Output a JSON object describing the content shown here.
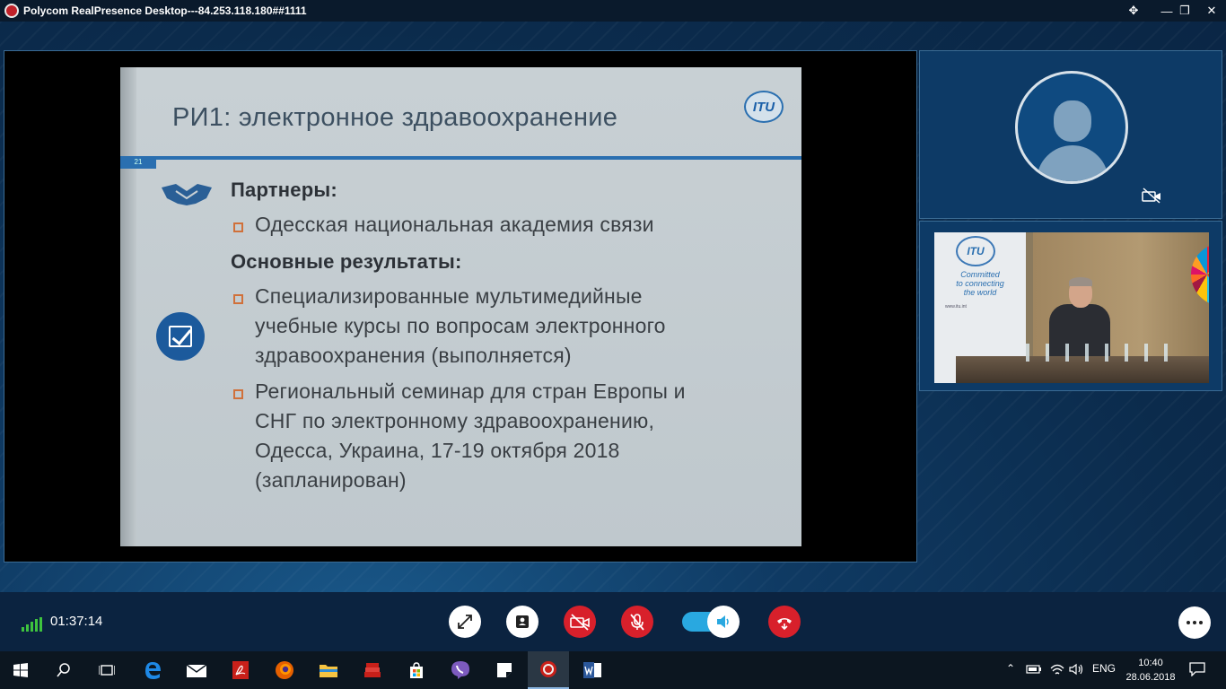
{
  "window": {
    "title": "Polycom RealPresence Desktop---84.253.118.180##1111",
    "pin": "✥",
    "minimize": "—",
    "maximize": "❐",
    "close": "✕"
  },
  "slide": {
    "title": "РИ1: электронное здравоохранение",
    "logo": "ITU",
    "page_number": "21",
    "partners_heading": "Партнеры:",
    "partners": [
      "Одесская национальная академия связи"
    ],
    "results_heading": "Основные результаты:",
    "result1": [
      "Специализированные мультимедийные",
      "учебные курсы по вопросам электронного",
      "здравоохранения (выполняется)"
    ],
    "result2": [
      "Региональный семинар для стран Европы и",
      "СНГ по электронному здравоохранению,",
      "Одесса, Украина, 17-19 октября 2018",
      "(запланирован)"
    ]
  },
  "room_video": {
    "logo": "ITU",
    "tagline": [
      "Committed",
      "to connecting",
      "the world"
    ],
    "url": "www.itu.int"
  },
  "call": {
    "duration": "01:37:14",
    "signal_bars": 5,
    "speaker_on": true
  },
  "taskbar": {
    "language": "ENG",
    "time": "10:40",
    "date": "28.06.2018"
  },
  "colors": {
    "accent": "#2a6fb0",
    "hangup": "#d8202b",
    "signal": "#3ec33e",
    "speaker_toggle": "#29a8e0"
  }
}
